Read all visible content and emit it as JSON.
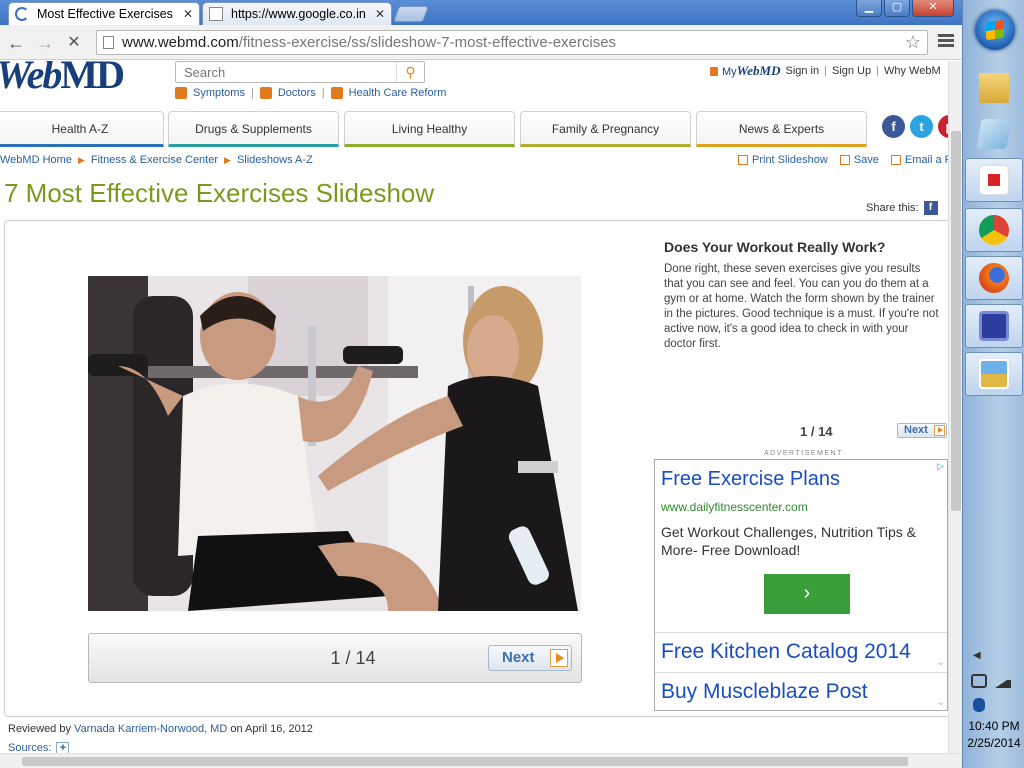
{
  "browser": {
    "tabs": [
      {
        "title": "Most Effective Exercises Pi",
        "state": "loading"
      },
      {
        "title": "https://www.google.co.in",
        "state": "idle"
      }
    ],
    "url_host": "www.webmd.com",
    "url_path": "/fitness-exercise/ss/slideshow-7-most-effective-exercises",
    "window_controls": {
      "minimize": "▁",
      "maximize": "▢",
      "close": "✕"
    }
  },
  "header": {
    "logo_web": "Web",
    "logo_md": "MD",
    "search_placeholder": "Search",
    "quicklinks": [
      "Symptoms",
      "Doctors",
      "Health Care Reform"
    ],
    "user": {
      "my": "My",
      "webmd": "WebMD",
      "sign_in": "Sign in",
      "sign_up": "Sign Up",
      "why": "Why WebM"
    }
  },
  "nav": {
    "tabs": [
      {
        "label": "Health A-Z",
        "color": "#2a72b8"
      },
      {
        "label": "Drugs & Supplements",
        "color": "#2a9ea0"
      },
      {
        "label": "Living Healthy",
        "color": "#8ab02a"
      },
      {
        "label": "Family & Pregnancy",
        "color": "#b0b02a"
      },
      {
        "label": "News & Experts",
        "color": "#e0a020"
      }
    ],
    "social": {
      "facebook": "f",
      "twitter": "t",
      "pinterest": "p"
    }
  },
  "breadcrumb": [
    "WebMD Home",
    "Fitness & Exercise Center",
    "Slideshows A-Z"
  ],
  "tools": {
    "print": "Print Slideshow",
    "save": "Save",
    "email": "Email a Fr"
  },
  "page": {
    "title": "7 Most Effective Exercises Slideshow",
    "share_label": "Share this:",
    "share_icon": "f"
  },
  "slide": {
    "counter": "1 / 14",
    "next_label": "Next",
    "heading": "Does Your Workout Really Work?",
    "body": "Done right, these seven exercises give you results that you can see and feel. You can you do them at a gym or at home. Watch the form shown by the trainer in the pictures. Good technique is a must. If you're not active now, it's a good idea to check in with your doctor first.",
    "side_counter": "1 / 14",
    "side_next": "Next"
  },
  "ad": {
    "label": "ADVERTISEMENT",
    "headline": "Free Exercise Plans",
    "url": "www.dailyfitnesscenter.com",
    "description": "Get Workout Challenges, Nutrition Tips & More- Free Download!",
    "go": "›",
    "links": [
      "Free Kitchen Catalog 2014",
      "Buy Muscleblaze Post"
    ]
  },
  "footer": {
    "reviewed_prefix": "Reviewed by ",
    "reviewer": "Varnada Karriem-Norwood, MD",
    "reviewed_suffix": " on April 16, 2012",
    "sources": "Sources:",
    "sources_toggle": "+"
  },
  "taskbar": {
    "pinned": [
      "file-explorer-icon",
      "notepad-icon",
      "airtel-icon",
      "chrome-icon",
      "firefox-icon",
      "remote-display-icon",
      "photo-viewer-icon"
    ],
    "time": "10:40 PM",
    "date": "2/25/2014"
  }
}
